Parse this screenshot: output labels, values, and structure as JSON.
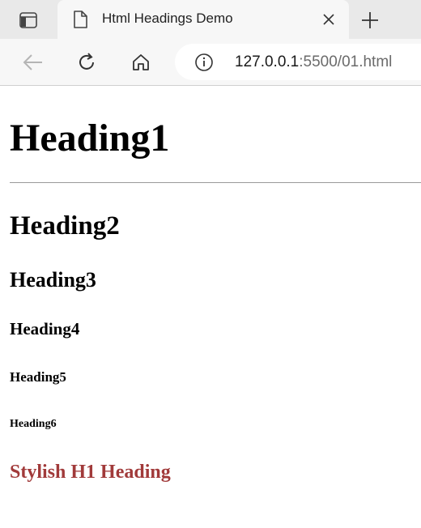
{
  "browser": {
    "tab": {
      "title": "Html Headings Demo"
    },
    "address_bar": {
      "url_host": "127.0.0.1",
      "url_rest": ":5500/01.html"
    }
  },
  "page": {
    "heading1": "Heading1",
    "heading2": "Heading2",
    "heading3": "Heading3",
    "heading4": "Heading4",
    "heading5": "Heading5",
    "heading6": "Heading6",
    "stylish_heading": "Stylish H1 Heading"
  },
  "colors": {
    "stylish_heading": "#a13a3a",
    "tabstrip_bg": "#e9e9e9",
    "toolbar_bg": "#f7f7f7"
  }
}
